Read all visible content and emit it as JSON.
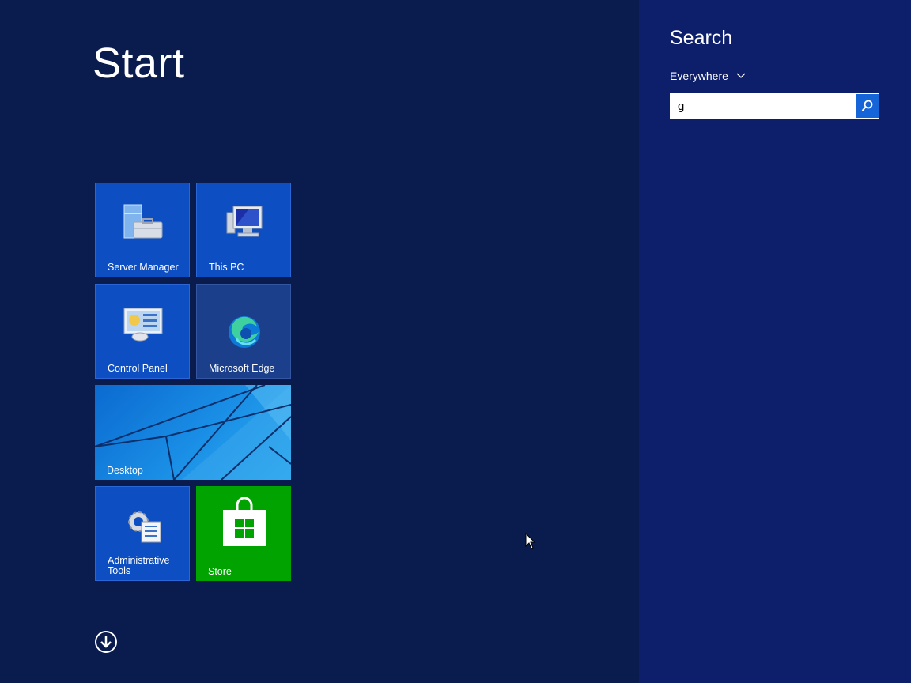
{
  "start": {
    "title": "Start"
  },
  "tiles": {
    "server_manager": {
      "label": "Server Manager",
      "icon": "server-manager-icon"
    },
    "this_pc": {
      "label": "This PC",
      "icon": "computer-icon"
    },
    "control_panel": {
      "label": "Control Panel",
      "icon": "control-panel-icon"
    },
    "microsoft_edge": {
      "label": "Microsoft Edge",
      "icon": "edge-icon"
    },
    "desktop": {
      "label": "Desktop",
      "icon": "desktop-wallpaper"
    },
    "administrative_tools": {
      "label": "Administrative Tools",
      "icon": "admin-tools-icon"
    },
    "store": {
      "label": "Store",
      "icon": "store-bag-icon"
    }
  },
  "apps_button": {
    "icon": "arrow-down-circle-icon"
  },
  "search": {
    "title": "Search",
    "scope": "Everywhere",
    "query": "g",
    "button_icon": "magnifier-icon"
  },
  "colors": {
    "start_background": "#0a1b4e",
    "search_background": "#0d1f6b",
    "tile_blue": "#0d4fc2",
    "tile_green": "#00a300",
    "search_button": "#1565d8"
  }
}
